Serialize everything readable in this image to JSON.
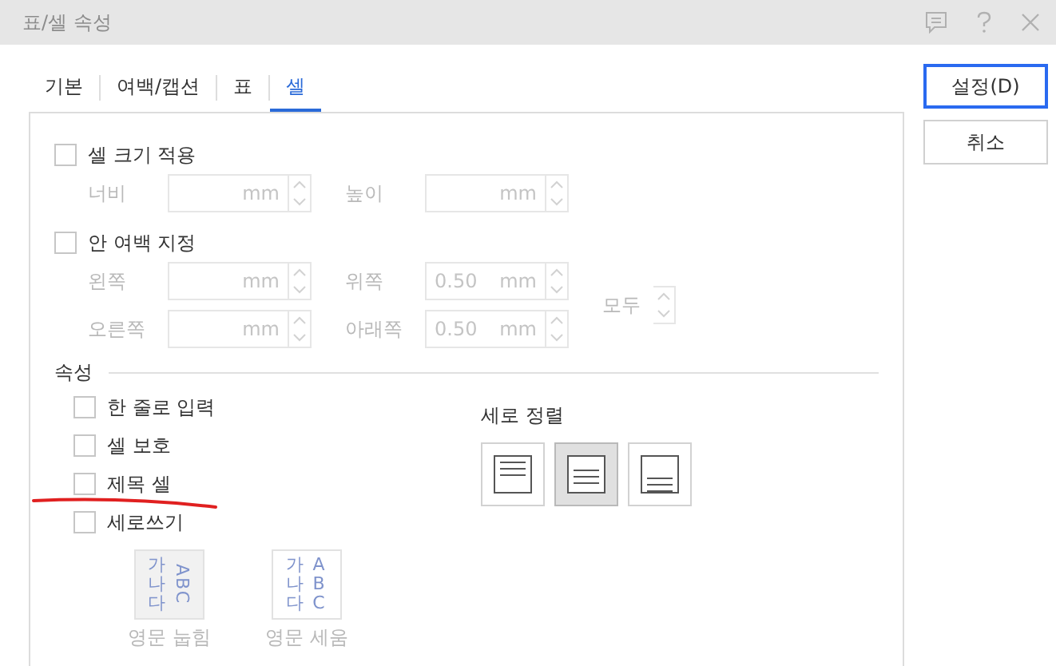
{
  "window": {
    "title": "표/셀 속성"
  },
  "tabs": [
    {
      "label": "기본",
      "selected": false
    },
    {
      "label": "여백/캡션",
      "selected": false
    },
    {
      "label": "표",
      "selected": false
    },
    {
      "label": "셀",
      "selected": true
    }
  ],
  "cell_size": {
    "label": "셀 크기 적용",
    "checked": false,
    "fields": [
      {
        "label": "너비",
        "unit": "mm",
        "disabled": true
      },
      {
        "label": "높이",
        "unit": "mm",
        "disabled": true
      }
    ]
  },
  "inner_margin": {
    "label": "안 여백 지정",
    "checked": false,
    "fields": [
      {
        "label": "왼쪽",
        "unit": "mm",
        "disabled": true
      },
      {
        "label": "위쪽",
        "value": "0.50",
        "unit": "mm",
        "disabled": true
      },
      {
        "label": "오른쪽",
        "unit": "mm",
        "disabled": true
      },
      {
        "label": "아래쪽",
        "value": "0.50",
        "unit": "mm",
        "disabled": true
      }
    ],
    "all": {
      "label": "모두",
      "disabled": true
    }
  },
  "properties": {
    "title": "속성",
    "options": [
      {
        "label": "한 줄로 입력",
        "checked": false
      },
      {
        "label": "셀 보호",
        "checked": false
      },
      {
        "label": "제목 셀",
        "checked": false
      },
      {
        "label": "세로쓰기",
        "checked": false
      }
    ],
    "vertical_text_styles": [
      {
        "label": "영문 눕힘",
        "kind": "rotated",
        "hangul": "가나다",
        "latin": "ABC",
        "selected": true,
        "disabled": true
      },
      {
        "label": "영문 세움",
        "kind": "upright",
        "hangul": "가나다",
        "latin": "ABC",
        "selected": false,
        "disabled": true
      }
    ]
  },
  "vertical_align": {
    "title": "세로 정렬",
    "options": [
      {
        "kind": "top",
        "selected": false
      },
      {
        "kind": "center",
        "selected": true
      },
      {
        "kind": "bottom",
        "selected": false
      }
    ]
  },
  "buttons": [
    {
      "label": "설정(D)",
      "default": true
    },
    {
      "label": "취소",
      "default": false
    }
  ]
}
